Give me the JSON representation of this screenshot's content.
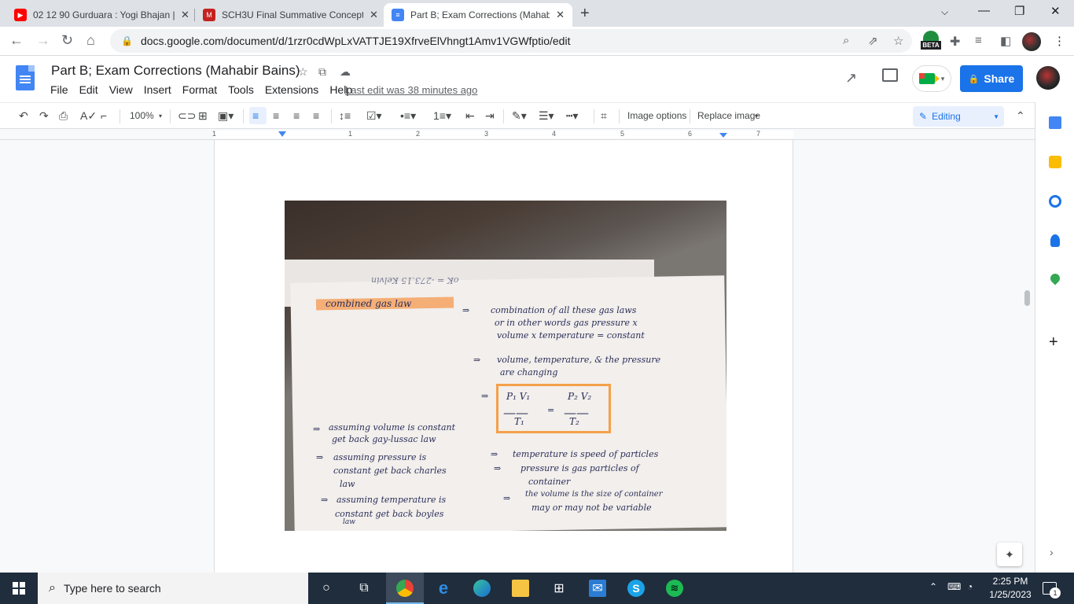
{
  "browser": {
    "tabs": [
      {
        "title": "02 12 90 Gurduara : Yogi Bhajan |",
        "favicon": "youtube-icon",
        "color": "#ff0000"
      },
      {
        "title": "SCH3U Final Summative Concept",
        "favicon": "notion-icon",
        "color": "#c5221f"
      },
      {
        "title": "Part B; Exam Corrections (Mahabir",
        "favicon": "docs-icon",
        "color": "#4285f4"
      }
    ],
    "url": "docs.google.com/document/d/1rzr0cdWpLxVATTJE19XfrveElVhngt1Amv1VGWfptio/edit",
    "beta_label": "BETA"
  },
  "docs": {
    "title": "Part B; Exam Corrections (Mahabir Bains)",
    "menu": [
      "File",
      "Edit",
      "View",
      "Insert",
      "Format",
      "Tools",
      "Extensions",
      "Help"
    ],
    "last_edit": "Last edit was 38 minutes ago",
    "share_label": "Share",
    "zoom": "100%",
    "image_options_label": "Image options",
    "replace_image_label": "Replace image",
    "mode_label": "Editing",
    "ruler_numbers": [
      "1",
      "1",
      "2",
      "3",
      "4",
      "5",
      "6",
      "7"
    ]
  },
  "photo_notes": {
    "top_mirrored": "oK = -273.15  Kelvin",
    "heading": "combined gas law",
    "line1": "combination of all these gas laws",
    "line2": "or in other words gas pressure x",
    "line3": "volume x temperature = constant",
    "line4": "volume, temperature, & the pressure",
    "line5": "are changing",
    "formula_left_top": "P₁ V₁",
    "formula_left_bottom": "T₁",
    "formula_right_top": "P₂ V₂",
    "formula_right_bottom": "T₂",
    "left1": "assuming volume is constant",
    "left1b": "get back gay-lussac law",
    "left2": "assuming pressure is",
    "left2b": "constant get back charles",
    "left2c": "law",
    "left3": "assuming temperature is",
    "left3b": "constant get back boyles",
    "left3c": "law",
    "right1": "temperature is speed of particles",
    "right2": "pressure is gas particles of",
    "right2b": "container",
    "right3": "the volume is the size of container",
    "right3b": "may or may not be variable"
  },
  "taskbar": {
    "search_placeholder": "Type here to search",
    "time": "2:25 PM",
    "date": "1/25/2023",
    "notification_count": "1"
  }
}
